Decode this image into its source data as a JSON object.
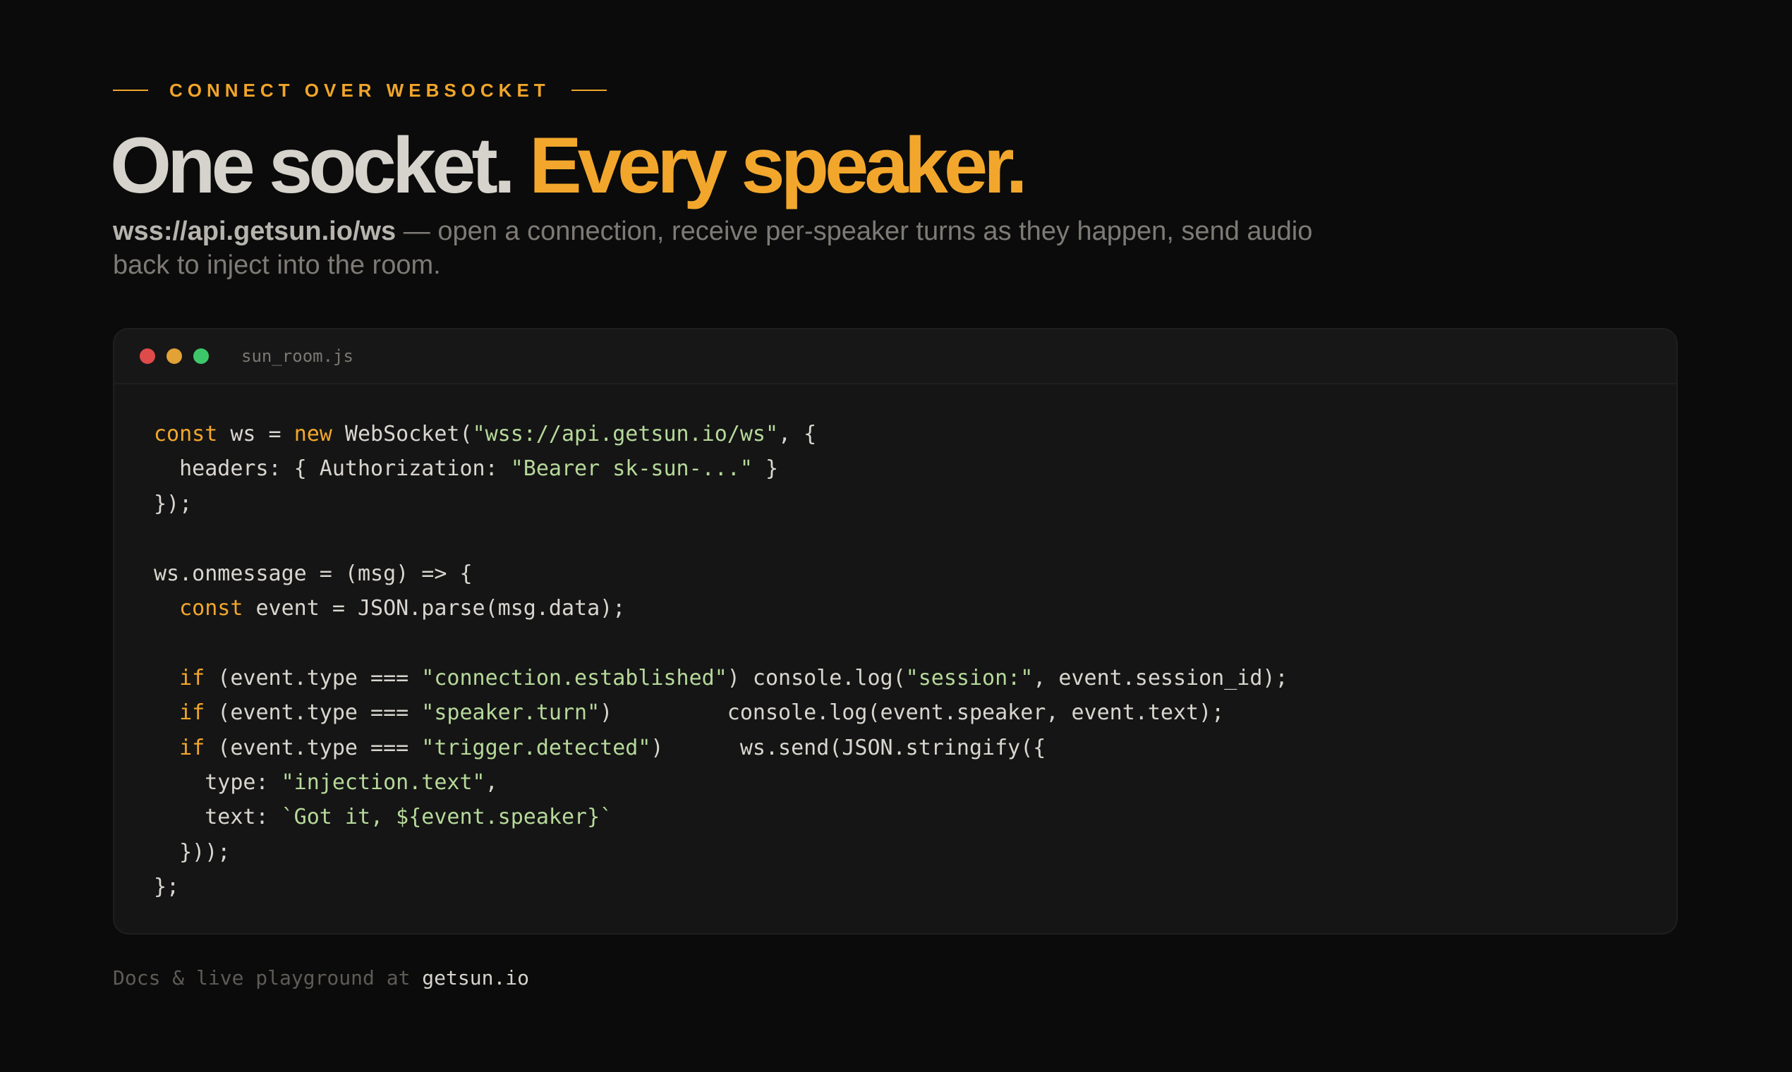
{
  "eyebrow": "CONNECT OVER WEBSOCKET",
  "headline": {
    "part1": "One socket.",
    "part2": "Every speaker."
  },
  "subtitle": {
    "url": "wss://api.getsun.io/ws",
    "text": " — open a connection, receive per-speaker turns as they happen, send audio back to inject into the room."
  },
  "code_window": {
    "filename": "sun_room.js",
    "lines": [
      "const ws = new WebSocket(\"wss://api.getsun.io/ws\", {",
      "  headers: { Authorization: \"Bearer sk-sun-...\" }",
      "});",
      "",
      "ws.onmessage = (msg) => {",
      "  const event = JSON.parse(msg.data);",
      "",
      "  if (event.type === \"connection.established\") console.log(\"session:\", event.session_id);",
      "  if (event.type === \"speaker.turn\")         console.log(event.speaker, event.text);",
      "  if (event.type === \"trigger.detected\")      ws.send(JSON.stringify({",
      "    type: \"injection.text\",",
      "    text: `Got it, ${event.speaker}`",
      "  }));",
      "};"
    ]
  },
  "footer": {
    "text": "Docs & live playground at ",
    "link": "getsun.io"
  },
  "colors": {
    "accent": "#f2a72c",
    "string": "#b6d99a",
    "background": "#0b0b0b",
    "card": "#151515"
  }
}
